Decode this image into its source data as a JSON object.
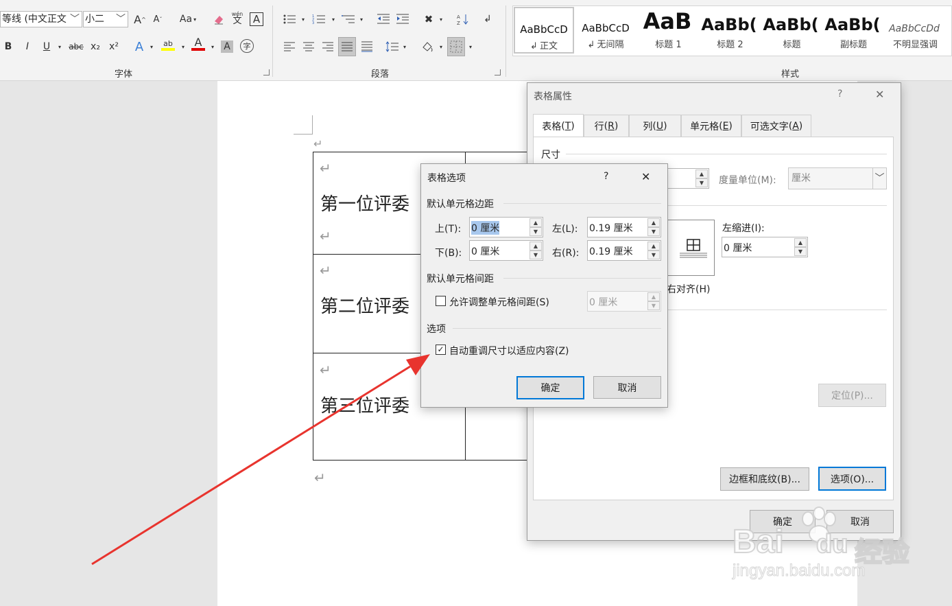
{
  "ribbon": {
    "font_name": "等线 (中文正文",
    "font_size": "小二",
    "grow_font": "A",
    "shrink_font": "A",
    "change_case": "Aa",
    "phonetic_guide": "wén",
    "format_buttons": [
      "B",
      "I",
      "U",
      "abc",
      "x₂",
      "x²"
    ],
    "font_group_label": "字体",
    "paragraph_group_label": "段落",
    "styles_group_label": "样式",
    "styles": [
      {
        "preview": "AaBbCcD",
        "name": "正文",
        "mark": "↲"
      },
      {
        "preview": "AaBbCcD",
        "name": "无间隔",
        "mark": "↲"
      },
      {
        "preview": "AaB",
        "name": "标题 1",
        "mark": ""
      },
      {
        "preview": "AaBb(",
        "name": "标题 2",
        "mark": ""
      },
      {
        "preview": "AaBb(",
        "name": "标题",
        "mark": ""
      },
      {
        "preview": "AaBb(",
        "name": "副标题",
        "mark": ""
      },
      {
        "preview": "AaBbCcDd",
        "name": "不明显强调",
        "mark": ""
      }
    ],
    "colors": {
      "highlight": "#ffff00",
      "font_color": "#e00000"
    }
  },
  "document": {
    "paragraph_mark": "↵",
    "table_rows": [
      "第一位评委",
      "第二位评委",
      "第三位评委"
    ]
  },
  "table_properties": {
    "title": "表格属性",
    "help": "?",
    "close": "✕",
    "tabs": [
      {
        "label": "表格",
        "key": "T"
      },
      {
        "label": "行",
        "key": "R"
      },
      {
        "label": "列",
        "key": "U"
      },
      {
        "label": "单元格",
        "key": "E"
      },
      {
        "label": "可选文字",
        "key": "A"
      }
    ],
    "size_section": "尺寸",
    "measure_unit_label": "度量单位(M):",
    "measure_unit_value": "厘米",
    "left_indent_label": "左缩进(I):",
    "left_indent_value": "0 厘米",
    "align_right_label": "右对齐(H)",
    "position_button": "定位(P)...",
    "borders_button": "边框和底纹(B)...",
    "options_button": "选项(O)...",
    "ok_button": "确定",
    "cancel_button": "取消"
  },
  "table_options": {
    "title": "表格选项",
    "help": "?",
    "close": "✕",
    "margins_section": "默认单元格边距",
    "top_label": "上(T):",
    "top_value": "0 厘米",
    "bottom_label": "下(B):",
    "bottom_value": "0 厘米",
    "left_label": "左(L):",
    "left_value": "0.19 厘米",
    "right_label": "右(R):",
    "right_value": "0.19 厘米",
    "spacing_section": "默认单元格间距",
    "allow_spacing_label": "允许调整单元格间距(S)",
    "allow_spacing_checked": false,
    "spacing_value": "0 厘米",
    "options_section": "选项",
    "autoresize_label": "自动重调尺寸以适应内容(Z)",
    "autoresize_checked": true,
    "ok_button": "确定",
    "cancel_button": "取消"
  },
  "watermark": {
    "brand": "Bai",
    "brand_suffix": "经验",
    "url": "jingyan.baidu.com"
  },
  "annotation": {
    "arrow_color": "#e8342e"
  }
}
